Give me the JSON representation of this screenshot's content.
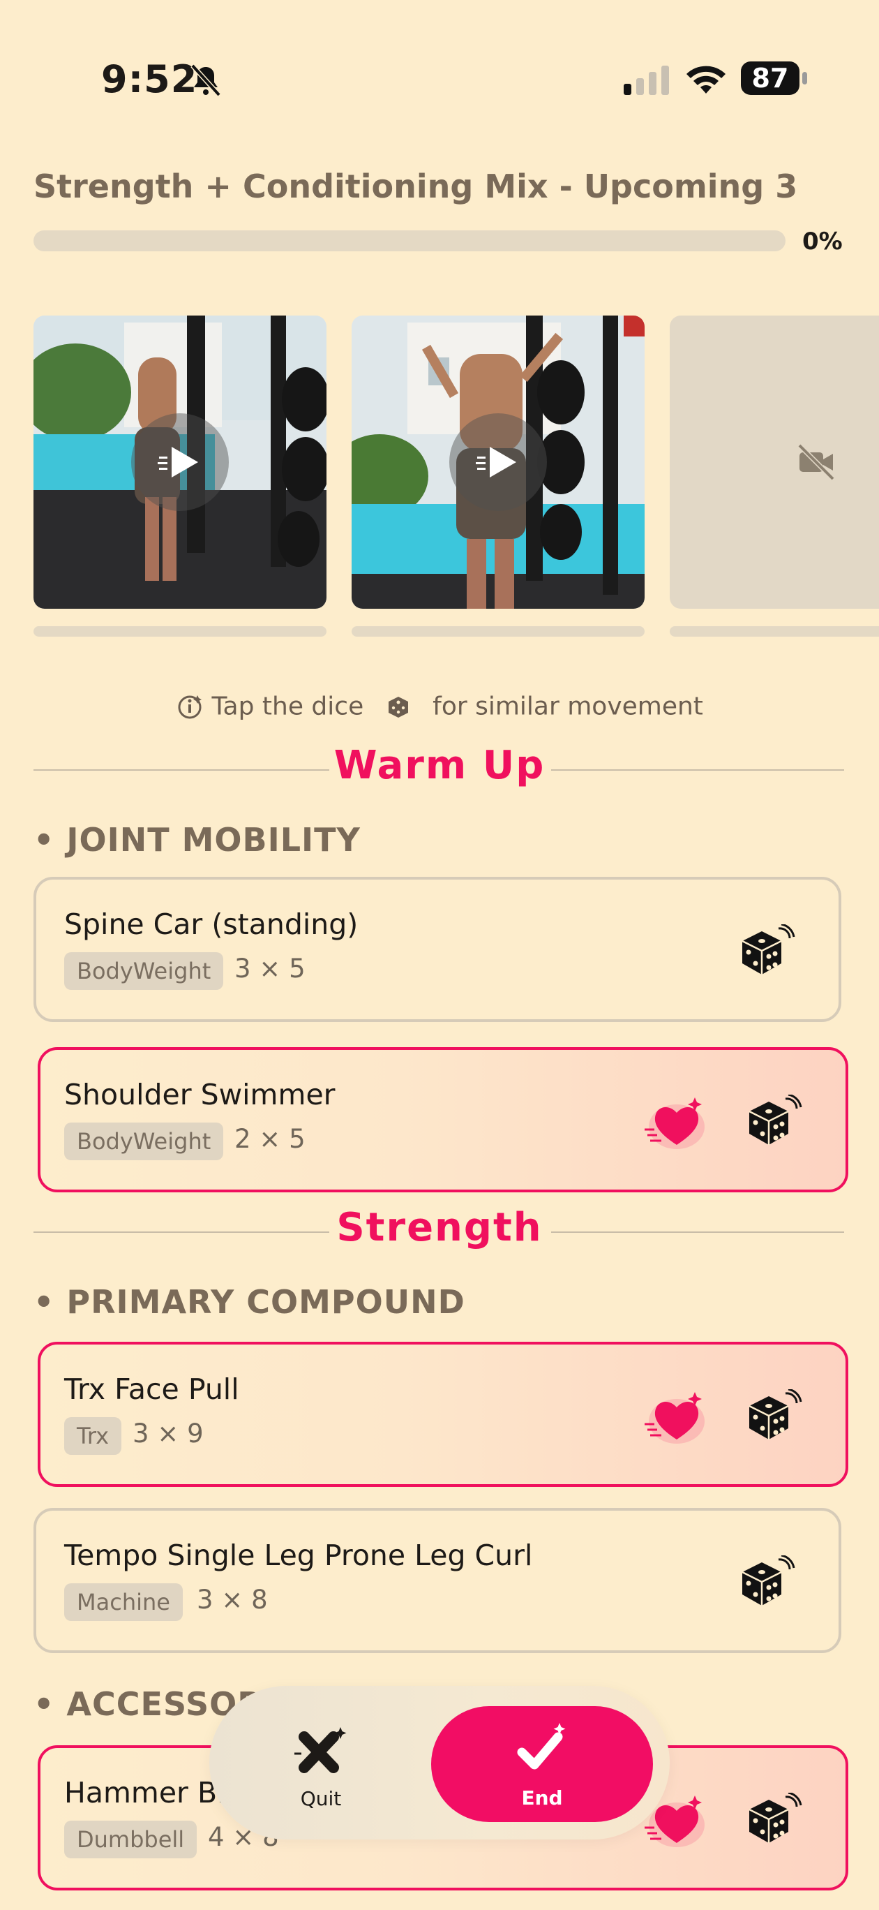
{
  "status_bar": {
    "time": "9:52",
    "battery": "87"
  },
  "workout": {
    "title": "Strength + Conditioning Mix - Upcoming 3",
    "progress_label": "0%",
    "progress": 0
  },
  "hint": {
    "part1": "Tap the dice",
    "part2": "for similar movement"
  },
  "sections": {
    "warmup": "Warm Up",
    "strength": "Strength"
  },
  "groups": {
    "joint_mobility": "JOINT MOBILITY",
    "primary_compound": "PRIMARY COMPOUND",
    "accessory": "ACCESSORY"
  },
  "exercises": [
    {
      "name": "Spine Car (standing)",
      "equipment": "BodyWeight",
      "reps": "3 × 5",
      "favorite": false
    },
    {
      "name": "Shoulder Swimmer",
      "equipment": "BodyWeight",
      "reps": "2 × 5",
      "favorite": true
    },
    {
      "name": "Trx Face Pull",
      "equipment": "Trx",
      "reps": "3 × 9",
      "favorite": true
    },
    {
      "name": "Tempo Single Leg Prone Leg Curl",
      "equipment": "Machine",
      "reps": "3 × 8",
      "favorite": false
    },
    {
      "name": "Hammer Bi",
      "equipment": "Dumbbell",
      "reps": "4 × 8",
      "favorite": true
    }
  ],
  "actions": {
    "quit": "Quit",
    "end": "End"
  },
  "colors": {
    "accent": "#f0105e",
    "background": "#fdedcc",
    "muted": "#7a6a58"
  }
}
